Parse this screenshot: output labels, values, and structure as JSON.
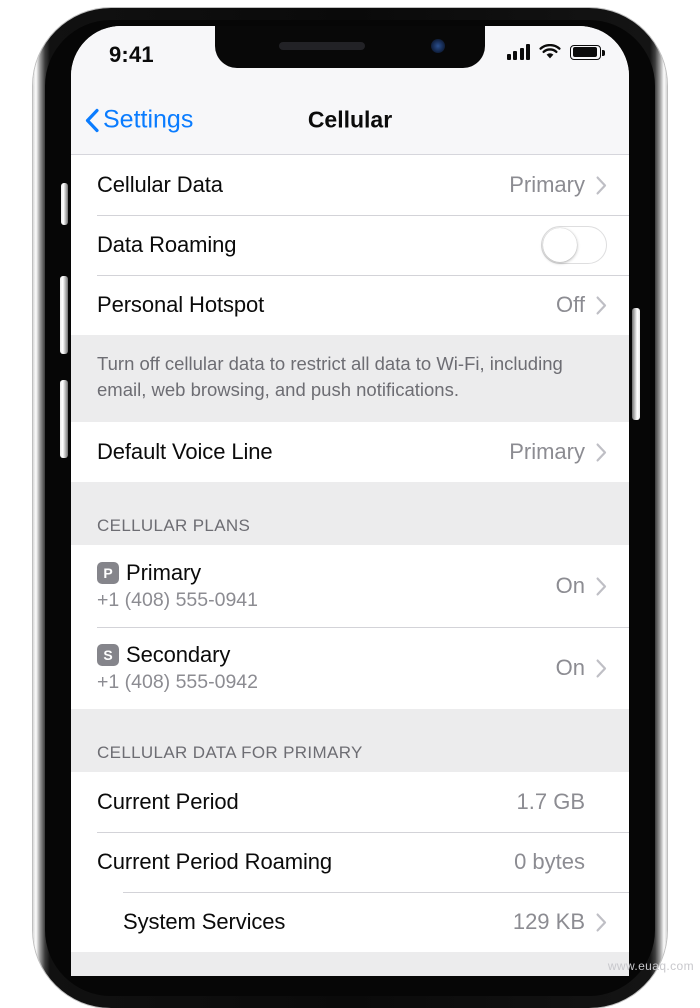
{
  "status_bar": {
    "time": "9:41",
    "signal_icon": "cellular-signal-icon",
    "wifi_icon": "wifi-icon",
    "battery_icon": "battery-icon"
  },
  "nav": {
    "back_label": "Settings",
    "back_icon": "chevron-left-icon",
    "title": "Cellular"
  },
  "colors": {
    "accent": "#0a7cff",
    "label": "#0b0b0b",
    "secondary": "#8c8c92",
    "group_bg": "#ececed",
    "row_bg": "#ffffff",
    "separator": "#d3d3d8",
    "badge": "#85858b"
  },
  "groups": [
    {
      "rows": [
        {
          "label": "Cellular Data",
          "value": "Primary",
          "type": "disclosure"
        },
        {
          "label": "Data Roaming",
          "value": "",
          "type": "toggle",
          "toggle_on": false
        },
        {
          "label": "Personal Hotspot",
          "value": "Off",
          "type": "disclosure"
        }
      ],
      "footer": "Turn off cellular data to restrict all data to Wi-Fi, including email, web browsing, and push notifications."
    },
    {
      "rows": [
        {
          "label": "Default Voice Line",
          "value": "Primary",
          "type": "disclosure"
        }
      ]
    },
    {
      "header": "CELLULAR PLANS",
      "plans": [
        {
          "badge": "P",
          "name": "Primary",
          "number": "+1 (408) 555-0941",
          "value": "On"
        },
        {
          "badge": "S",
          "name": "Secondary",
          "number": "+1 (408) 555-0942",
          "value": "On"
        }
      ]
    },
    {
      "header": "CELLULAR DATA FOR PRIMARY",
      "rows": [
        {
          "label": "Current Period",
          "value": "1.7 GB",
          "type": "plain"
        },
        {
          "label": "Current Period Roaming",
          "value": "0 bytes",
          "type": "plain"
        },
        {
          "label": "System Services",
          "value": "129 KB",
          "type": "disclosure",
          "indent": true
        }
      ]
    }
  ],
  "watermark": "www.euaq.com"
}
